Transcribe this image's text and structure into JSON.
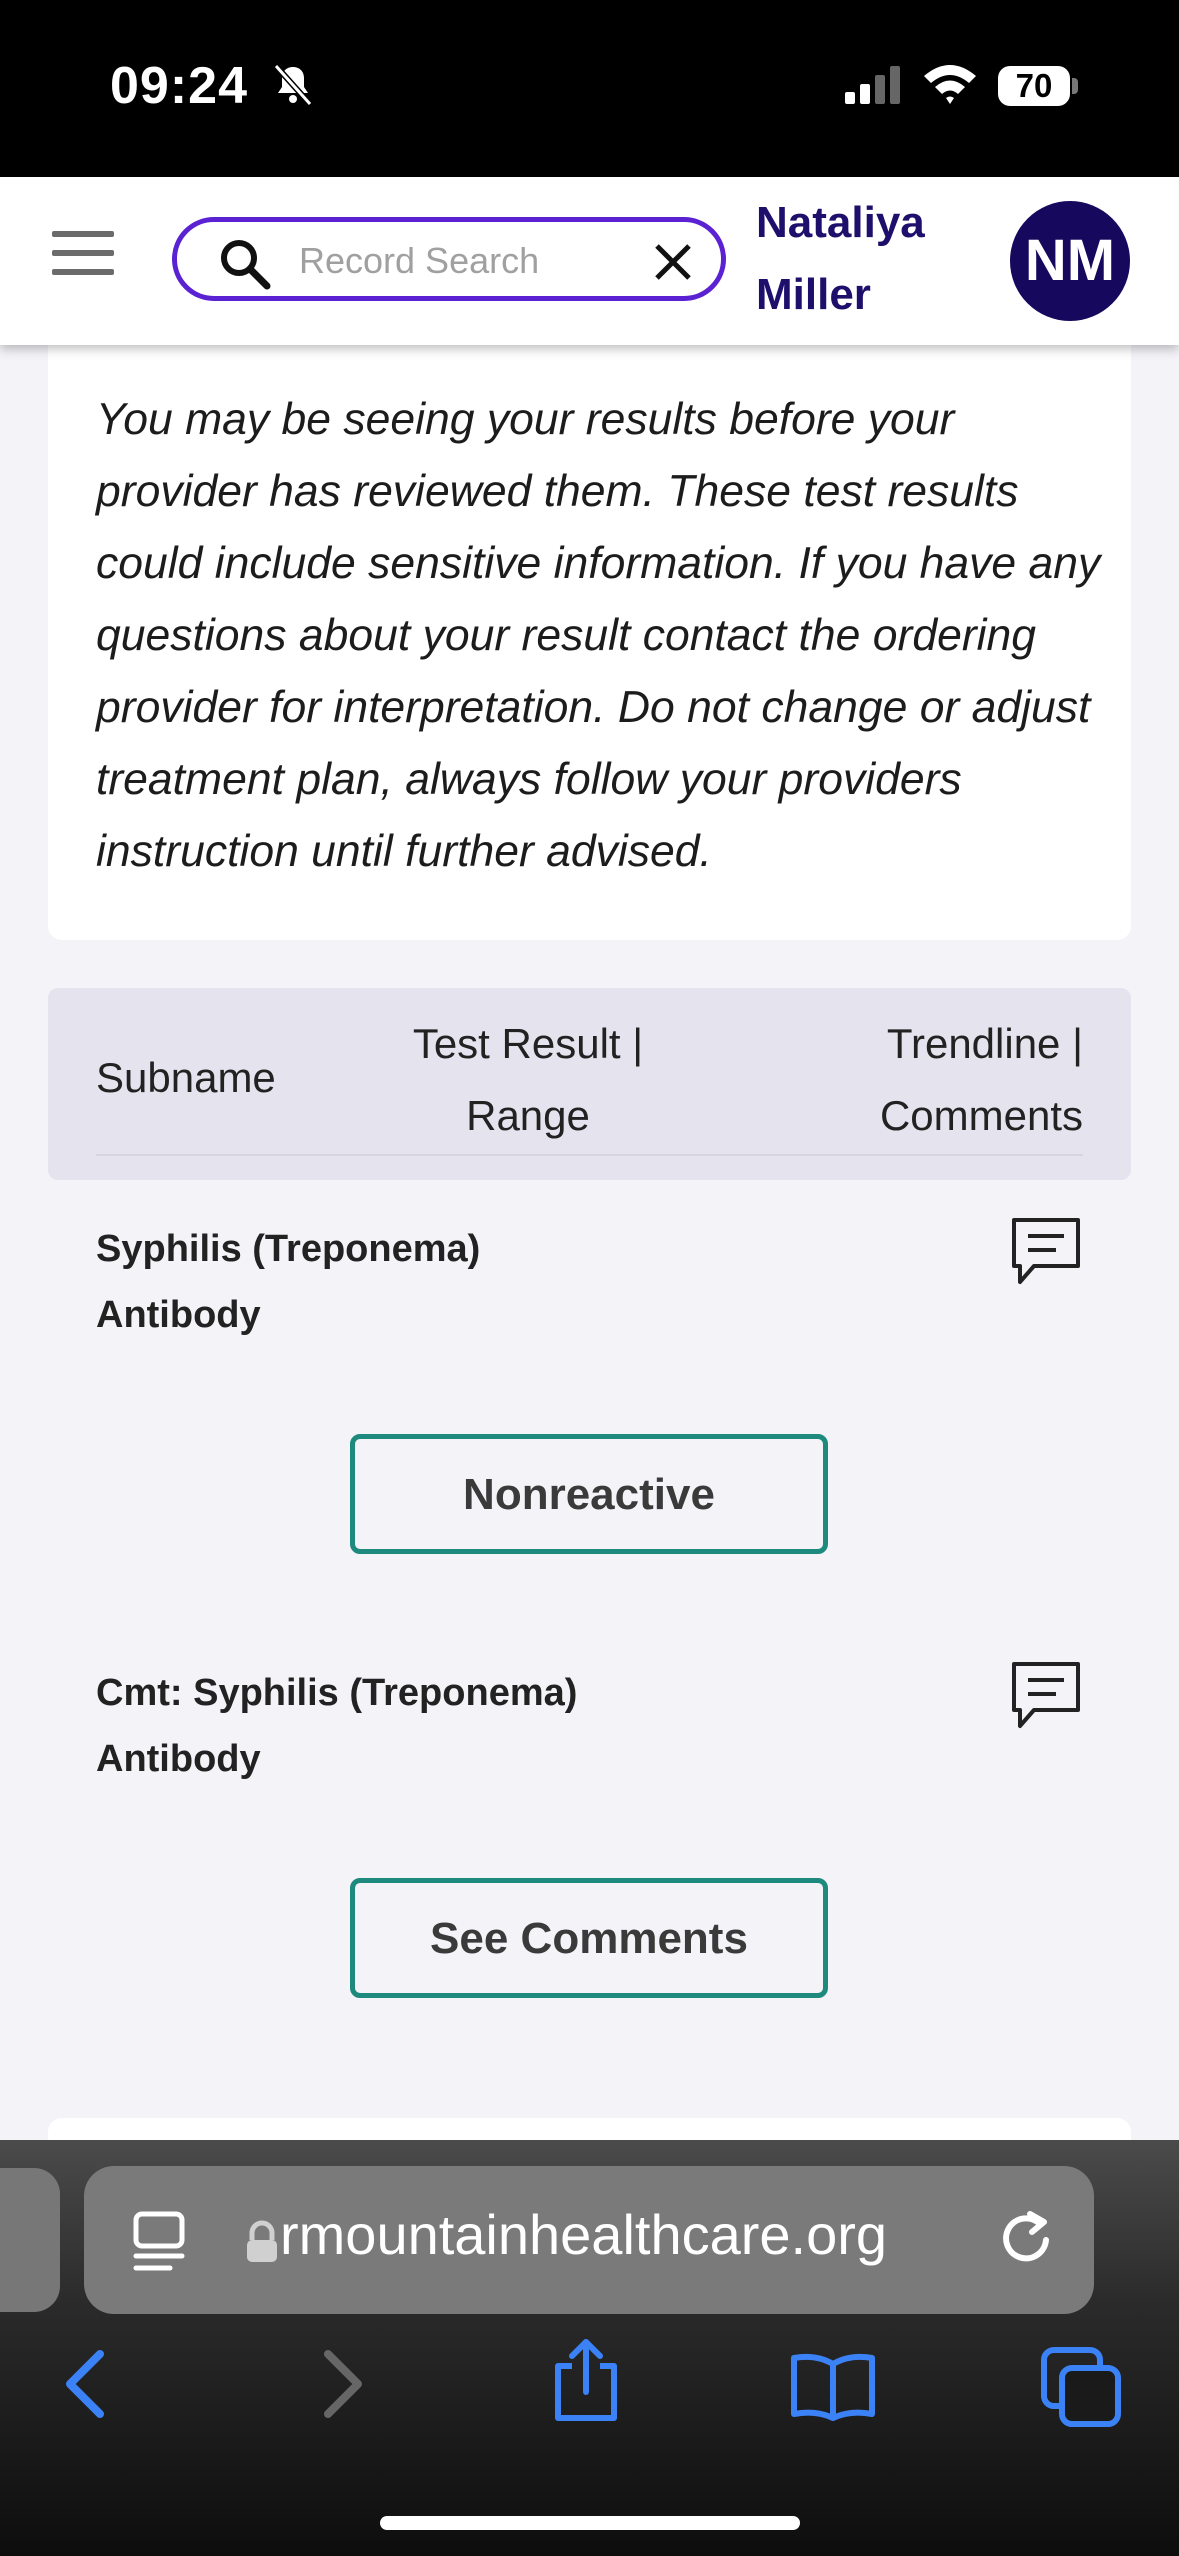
{
  "status": {
    "time": "09:24",
    "battery": "70"
  },
  "header": {
    "search_placeholder": "Record Search",
    "user_first": "Nataliya",
    "user_last": "Miller",
    "avatar_initials": "NM"
  },
  "notice": {
    "text": "You may be seeing your results before your provider has reviewed them. These test results could include sensitive information. If you have any questions about your result contact the ordering provider for interpretation. Do not change or adjust treatment plan, always follow your providers instruction until further advised."
  },
  "table": {
    "col_subname": "Subname",
    "col_result_line1": "Test Result |",
    "col_result_line2": "Range",
    "col_trend_line1": "Trendline |",
    "col_trend_line2": "Comments",
    "rows": [
      {
        "title_line1": "Syphilis (Treponema)",
        "title_line2": "Antibody",
        "action": "Nonreactive"
      },
      {
        "title_line1": "Cmt: Syphilis (Treponema)",
        "title_line2": "Antibody",
        "action": "See Comments"
      }
    ]
  },
  "browser": {
    "url": "rmountainhealthcare.org"
  },
  "colors": {
    "accent_purple": "#5a22d2",
    "brand_navy": "#16085c",
    "teal_border": "#1d8a7d",
    "ios_blue": "#3b82f6"
  }
}
